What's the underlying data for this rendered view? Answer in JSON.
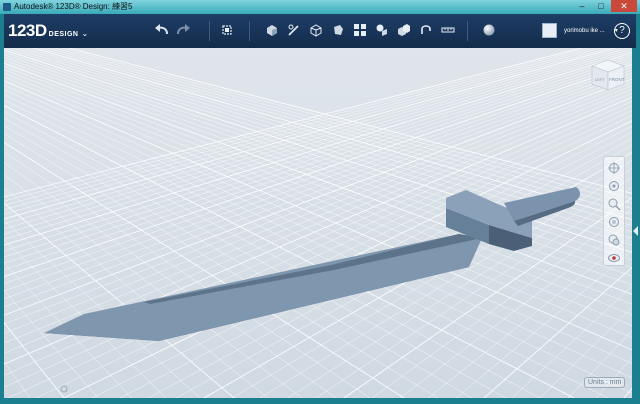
{
  "window": {
    "title": "Autodesk® 123D® Design: 練習5",
    "minimize_glyph": "–",
    "maximize_glyph": "□",
    "close_glyph": "✕"
  },
  "app": {
    "logo_main": "123D",
    "logo_sub": "DESIGN",
    "logo_menu_glyph": "⌄"
  },
  "toolbar": {
    "icons": [
      "undo-icon",
      "redo-icon",
      "transform-icon",
      "primitives-icon",
      "sketch-icon",
      "construct-icon",
      "modify-icon",
      "pattern-icon",
      "grouping-icon",
      "combine-icon",
      "measure-icon",
      "snap-icon",
      "text-icon",
      "material-icon"
    ]
  },
  "user": {
    "name": "yorimobu ike ...",
    "dropdown_glyph": "▾"
  },
  "help_glyph": "?",
  "viewcube": {
    "face_left": "LEFT",
    "face_front": "FRONT"
  },
  "units_label": "Units : mm",
  "accent_colors": {
    "toolbar": "#1a3459",
    "window_frame": "#1c7f8f",
    "model": "#7c93ad"
  }
}
